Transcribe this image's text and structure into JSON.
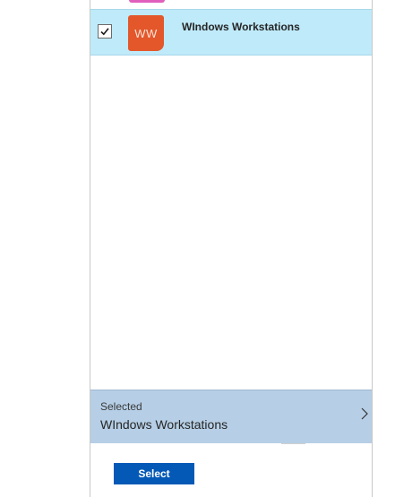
{
  "list": {
    "items": [
      {
        "tile_initials": "WW",
        "title": "WIndows Workstations",
        "checked": true,
        "tile_color": "#e3572b"
      }
    ],
    "previous_tile_color": "#e05fbd",
    "selected_row_color": "#bfeafa"
  },
  "selection": {
    "caption": "Selected",
    "value": "WIndows Workstations",
    "bar_color": "#b6cfe6"
  },
  "footer": {
    "select_label": "Select",
    "button_color": "#0559b6"
  },
  "icons": {
    "checkmark": "checkmark-icon",
    "chevron": "chevron-right-icon"
  }
}
